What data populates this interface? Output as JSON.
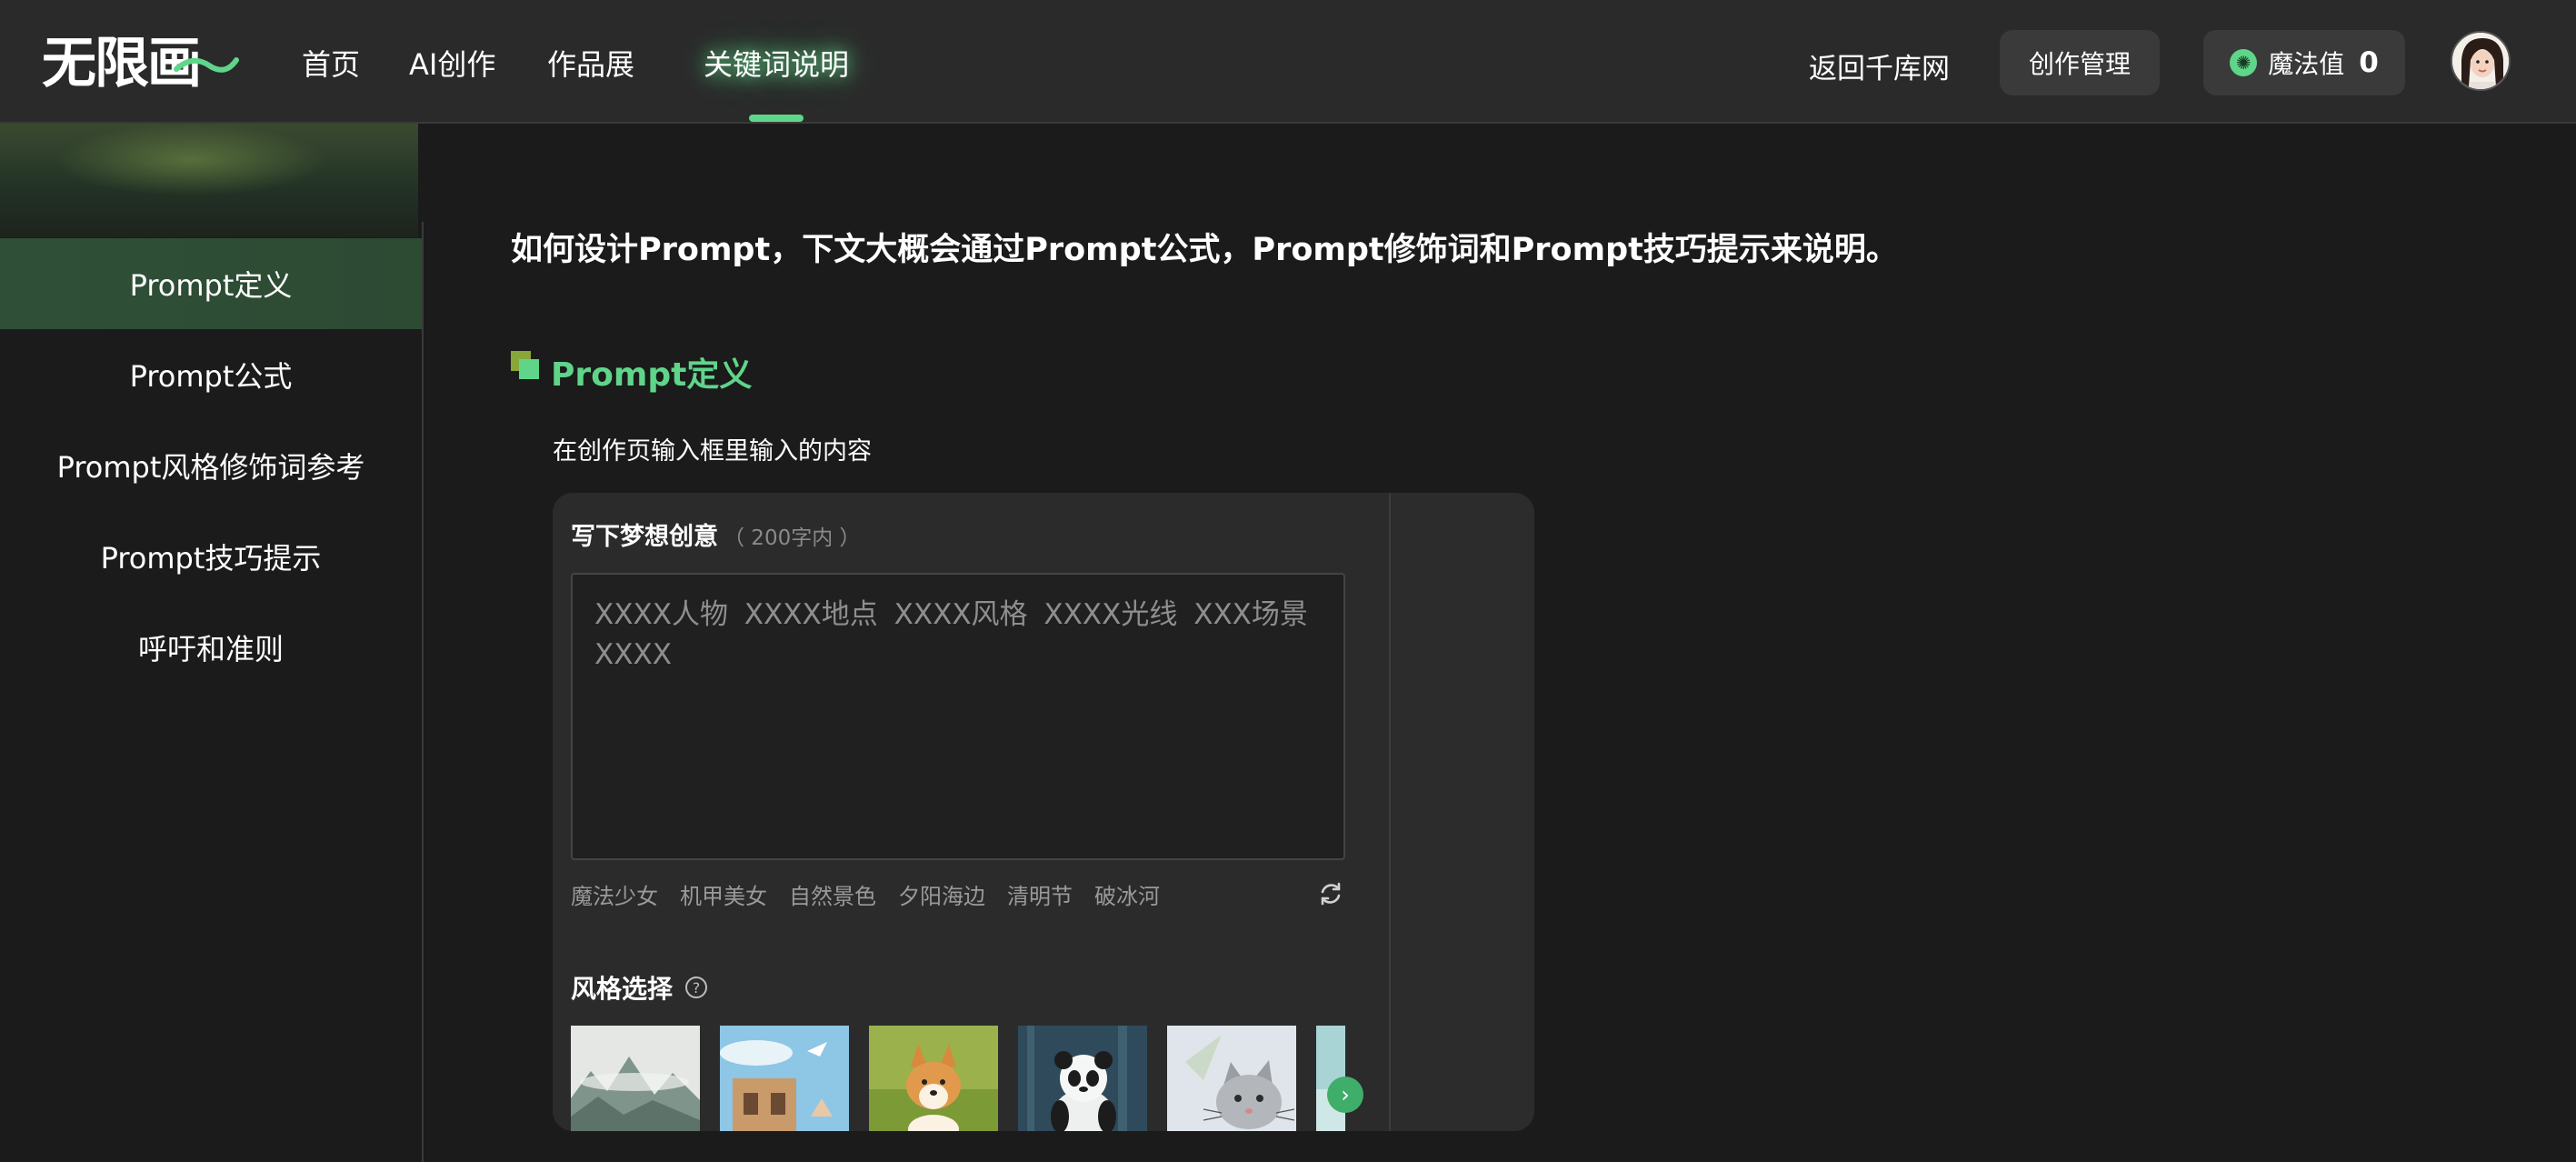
{
  "header": {
    "logo_text": "无限画",
    "nav": [
      {
        "label": "首页"
      },
      {
        "label": "AI创作"
      },
      {
        "label": "作品展"
      },
      {
        "label": "关键词说明",
        "active": true
      }
    ],
    "back_link": "返回千库网",
    "manage_button": "创作管理",
    "magic": {
      "label": "魔法值",
      "value": "0",
      "icon": "magic-coin-icon"
    },
    "avatar_icon": "user-avatar"
  },
  "sidebar": {
    "items": [
      {
        "label": "Prompt定义",
        "active": true
      },
      {
        "label": "Prompt公式"
      },
      {
        "label": "Prompt风格修饰词参考"
      },
      {
        "label": "Prompt技巧提示"
      },
      {
        "label": "呼吁和准则"
      }
    ]
  },
  "main": {
    "intro": "如何设计Prompt，下文大概会通过Prompt公式，Prompt修饰词和Prompt技巧提示来说明。",
    "section": {
      "title": "Prompt定义",
      "description": "在创作页输入框里输入的内容"
    },
    "panel": {
      "title": "写下梦想创意",
      "hint": "（ 200字内 ）",
      "placeholder": "XXXX人物  XXXX地点  XXXX风格  XXXX光线  XXX场景  XXXX",
      "tags": [
        "魔法少女",
        "机甲美女",
        "自然景色",
        "夕阳海边",
        "清明节",
        "破冰河"
      ],
      "style_label": "风格选择",
      "styles": [
        {
          "icon": "ink-mountain-landscape"
        },
        {
          "icon": "anime-building-bird"
        },
        {
          "icon": "corgi-dog"
        },
        {
          "icon": "panda"
        },
        {
          "icon": "cat"
        },
        {
          "icon": "partial-style"
        }
      ]
    }
  },
  "colors": {
    "accent": "#5fd58a",
    "background": "#1b1b1b",
    "topbar": "#2a2a2a",
    "sidebar_active": "#2f5037"
  }
}
